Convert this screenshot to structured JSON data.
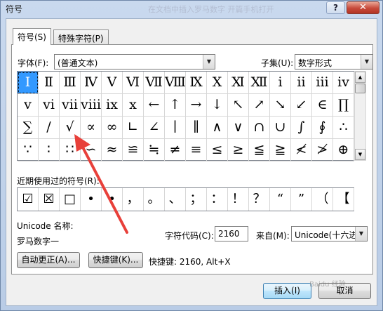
{
  "window": {
    "title": "符号",
    "help_label": "?",
    "close_label": "✕"
  },
  "watermark_top": "在文档中插入罗马数字   开篇手机打开",
  "tabs": [
    {
      "label": "符号(S)"
    },
    {
      "label": "特殊字符(P)"
    }
  ],
  "font": {
    "label": "字体(F):",
    "value": "(普通文本)"
  },
  "subset": {
    "label": "子集(U):",
    "value": "数字形式"
  },
  "symbols": [
    "Ⅰ",
    "Ⅱ",
    "Ⅲ",
    "Ⅳ",
    "Ⅴ",
    "Ⅵ",
    "Ⅶ",
    "Ⅷ",
    "Ⅸ",
    "Ⅹ",
    "Ⅺ",
    "Ⅻ",
    "ⅰ",
    "ⅱ",
    "ⅲ",
    "ⅳ",
    "ⅴ",
    "ⅵ",
    "ⅶ",
    "ⅷ",
    "ⅸ",
    "ⅹ",
    "←",
    "↑",
    "→",
    "↓",
    "↖",
    "↗",
    "↘",
    "↙",
    "∈",
    "∏",
    "∑",
    "∕",
    "√",
    "∝",
    "∞",
    "∟",
    "∠",
    "∣",
    "∥",
    "∧",
    "∨",
    "∩",
    "∪",
    "∫",
    "∮",
    "∴",
    "∵",
    "∶",
    "∷",
    "∽",
    "≈",
    "≌",
    "≒",
    "≠",
    "≡",
    "≤",
    "≥",
    "≦",
    "≧",
    "≮",
    "≯",
    "⊕"
  ],
  "recent": {
    "label": "近期使用过的符号(R):",
    "symbols": [
      "☑",
      "☒",
      "□",
      "•",
      "•",
      "，",
      "。",
      "、",
      "；",
      "：",
      "！",
      "？",
      "“",
      "”",
      "（",
      "【"
    ]
  },
  "unicode_name": {
    "label": "Unicode 名称:",
    "value": "罗马数字一"
  },
  "char_code": {
    "label": "字符代码(C):",
    "value": "2160"
  },
  "from": {
    "label": "来自(M):",
    "value": "Unicode(十六进制)"
  },
  "buttons": {
    "autocorrect": "自动更正(A)...",
    "shortcut_key": "快捷键(K)...",
    "insert": "插入(I)",
    "cancel": "取消"
  },
  "shortcut_text": "快捷键: 2160, Alt+X",
  "watermark": "Baidu 经验",
  "colors": {
    "selected": "#3399ff",
    "arrow": "#e8403a",
    "close": "#c7493a"
  }
}
